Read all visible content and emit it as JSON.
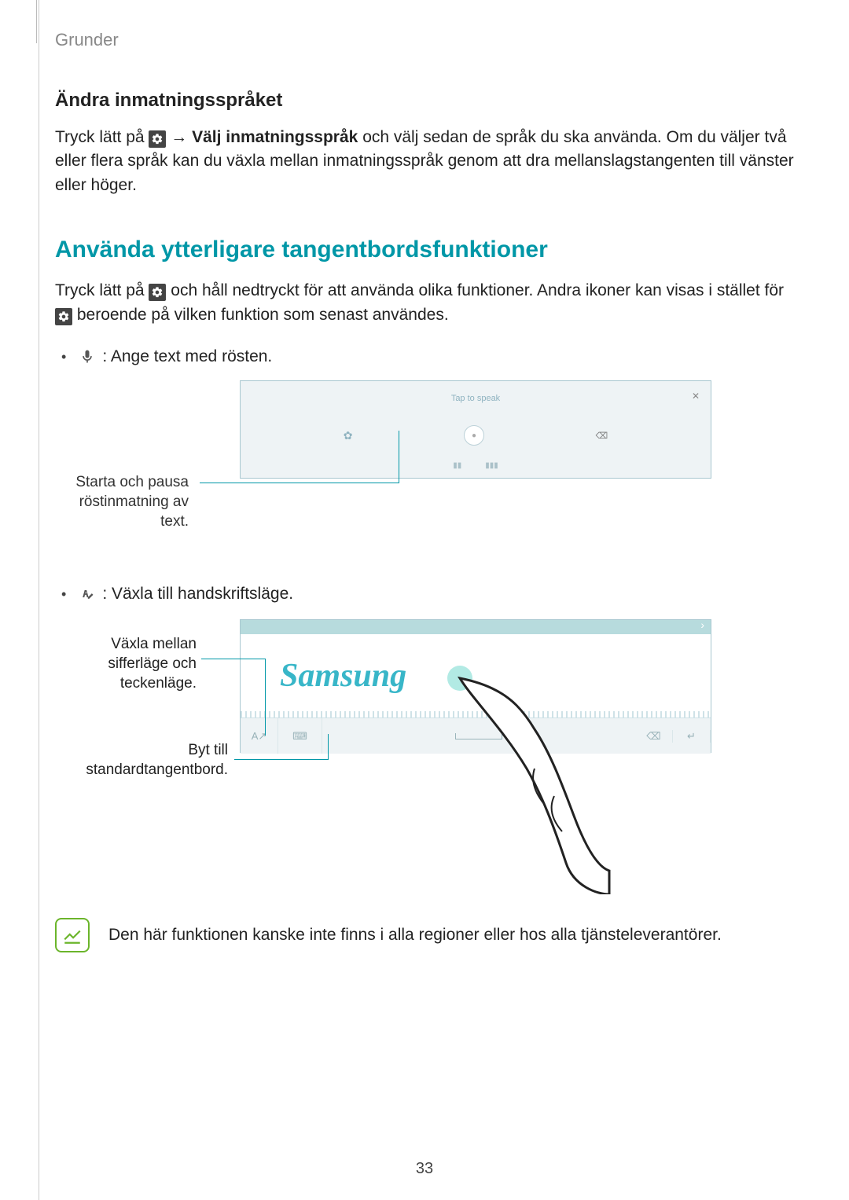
{
  "breadcrumb": "Grunder",
  "section1": {
    "heading": "Ändra inmatningsspråket",
    "p1_a": "Tryck lätt på ",
    "p1_b": " → ",
    "p1_bold": "Välj inmatningsspråk",
    "p1_c": " och välj sedan de språk du ska använda. Om du väljer två eller flera språk kan du växla mellan inmatningsspråk genom att dra mellanslagstangenten till vänster eller höger."
  },
  "section2": {
    "heading": "Använda ytterligare tangentbordsfunktioner",
    "p1_a": "Tryck lätt på ",
    "p1_b": " och håll nedtryckt för att använda olika funktioner. Andra ikoner kan visas i stället för ",
    "p1_c": " beroende på vilken funktion som senast användes.",
    "bullets": [
      {
        "text": ": Ange text med rösten."
      },
      {
        "text": ": Växla till handskriftsläge."
      }
    ]
  },
  "figure1": {
    "tap_to_speak": "Tap to speak",
    "callout": "Starta och pausa röstinmatning av text."
  },
  "figure2": {
    "handwriting": "Samsung",
    "callout_mode": "Växla mellan sifferläge och teckenläge.",
    "callout_kb": "Byt till standardtangentbord."
  },
  "note": "Den här funktionen kanske inte finns i alla regioner eller hos alla tjänsteleverantörer.",
  "page_number": "33"
}
